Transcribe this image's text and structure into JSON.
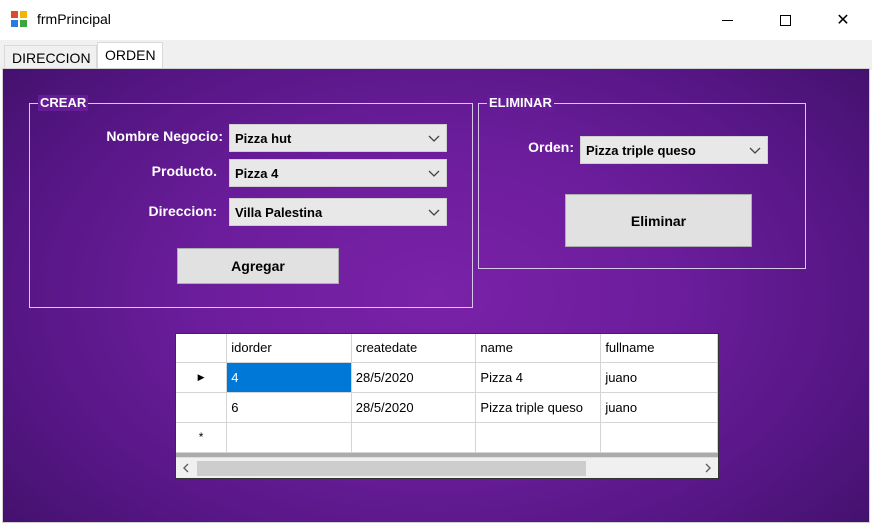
{
  "window": {
    "title": "frmPrincipal",
    "minimize_label": "",
    "maximize_label": "",
    "close_label": "✕"
  },
  "tabs": [
    {
      "label": "DIRECCION"
    },
    {
      "label": "ORDEN"
    }
  ],
  "crear": {
    "title": "CREAR",
    "negocio_label": "Nombre Negocio:",
    "negocio_value": "Pizza hut",
    "producto_label": "Producto.",
    "producto_value": "Pizza 4",
    "direccion_label": "Direccion:",
    "direccion_value": "Villa Palestina",
    "agregar_label": "Agregar"
  },
  "eliminar": {
    "title": "ELIMINAR",
    "orden_label": "Orden:",
    "orden_value": "Pizza triple queso",
    "eliminar_label": "Eliminar"
  },
  "grid": {
    "columns": [
      "idorder",
      "createdate",
      "name",
      "fullname"
    ],
    "rows": [
      {
        "idorder": "4",
        "createdate": "28/5/2020",
        "name": "Pizza 4",
        "fullname": "juano"
      },
      {
        "idorder": "6",
        "createdate": "28/5/2020",
        "name": "Pizza triple queso",
        "fullname": "juano"
      }
    ],
    "current_row_marker": "▶",
    "new_row_marker": "*"
  },
  "colors": {
    "panel_purple": "#6b1d9b",
    "selection_blue": "#0078d7"
  }
}
